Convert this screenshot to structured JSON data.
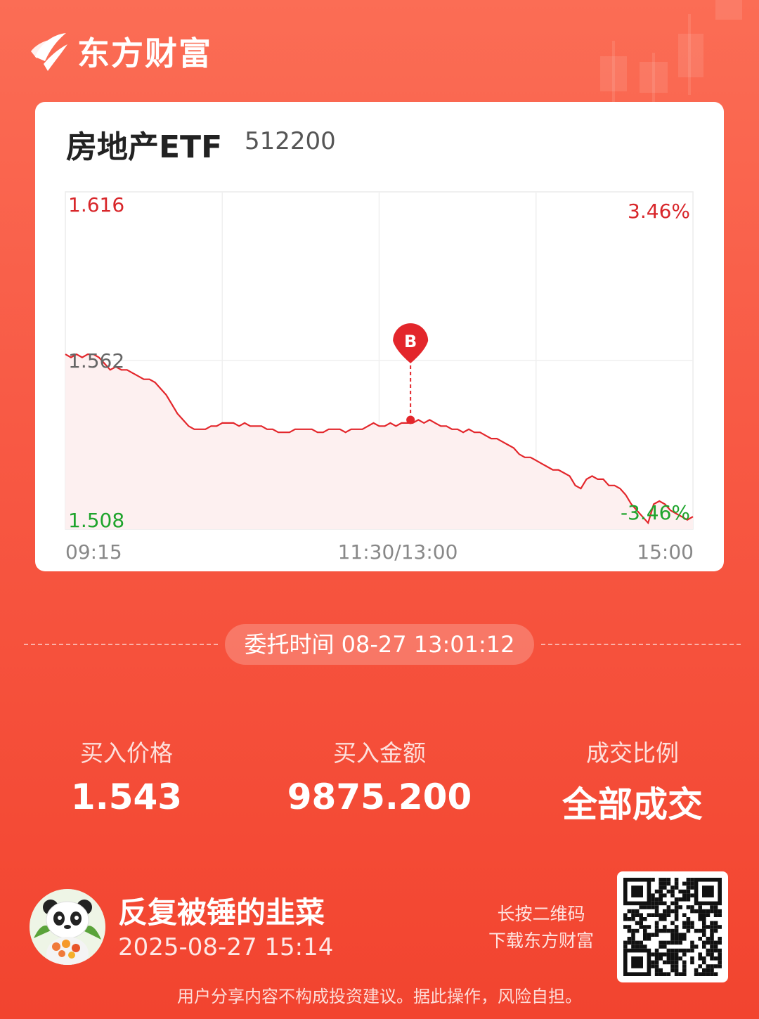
{
  "brand": {
    "name": "东方财富",
    "logo_icon": "eastmoney-logo-icon"
  },
  "card": {
    "title": "房地产ETF",
    "code": "512200"
  },
  "chart_data": {
    "type": "line",
    "y_price_labels": {
      "max": "1.616",
      "mid": "1.562",
      "min": "1.508"
    },
    "y_pct_labels": {
      "max": "3.46%",
      "min": "-3.46%"
    },
    "x_ticks": [
      "09:15",
      "11:30/13:00",
      "15:00"
    ],
    "ylim": [
      1.508,
      1.616
    ],
    "reference_price": 1.562,
    "series": [
      {
        "values": [
          1.564,
          1.563,
          1.564,
          1.563,
          1.564,
          1.564,
          1.563,
          1.561,
          1.559,
          1.56,
          1.559,
          1.559,
          1.558,
          1.557,
          1.556,
          1.556,
          1.555,
          1.553,
          1.551,
          1.548,
          1.545,
          1.543,
          1.541,
          1.54,
          1.54,
          1.54,
          1.541,
          1.541,
          1.542,
          1.542,
          1.542,
          1.541,
          1.542,
          1.541,
          1.541,
          1.541,
          1.54,
          1.54,
          1.539,
          1.539,
          1.539,
          1.54,
          1.54,
          1.54,
          1.54,
          1.539,
          1.539,
          1.54,
          1.54,
          1.54,
          1.539,
          1.54,
          1.54,
          1.54,
          1.541,
          1.542,
          1.541,
          1.541,
          1.542,
          1.541,
          1.542,
          1.542,
          1.542,
          1.543,
          1.542,
          1.543,
          1.542,
          1.541,
          1.541,
          1.54,
          1.54,
          1.539,
          1.54,
          1.539,
          1.539,
          1.538,
          1.537,
          1.537,
          1.536,
          1.535,
          1.534,
          1.532,
          1.531,
          1.531,
          1.53,
          1.529,
          1.528,
          1.527,
          1.527,
          1.526,
          1.525,
          1.522,
          1.521,
          1.524,
          1.525,
          1.524,
          1.524,
          1.522,
          1.522,
          1.521,
          1.519,
          1.516,
          1.514,
          1.512,
          1.51,
          1.516,
          1.517,
          1.516,
          1.514,
          1.513,
          1.512,
          1.511,
          1.512
        ],
        "color": "#e3262b",
        "fill": "#fdf0f0"
      }
    ],
    "buy_marker": {
      "label": "B",
      "price": 1.543,
      "index_fraction": 0.55
    },
    "grid": true
  },
  "order": {
    "time_label": "委托时间 08-27 13:01:12"
  },
  "stats": [
    {
      "label": "买入价格",
      "value": "1.543"
    },
    {
      "label": "买入金额",
      "value": "9875.200"
    },
    {
      "label": "成交比例",
      "value": "全部成交"
    }
  ],
  "user": {
    "name": "反复被锤的韭菜",
    "time": "2025-08-27 15:14",
    "avatar_icon": "panda-avatar-icon"
  },
  "qr": {
    "hint_line1": "长按二维码",
    "hint_line2": "下载东方财富",
    "icon": "qr-code-icon"
  },
  "disclaimer": "用户分享内容不构成投资建议。据此操作，风险自担。",
  "colors": {
    "up": "#d8262a",
    "down": "#1ea42c",
    "background": "#f85a45"
  }
}
